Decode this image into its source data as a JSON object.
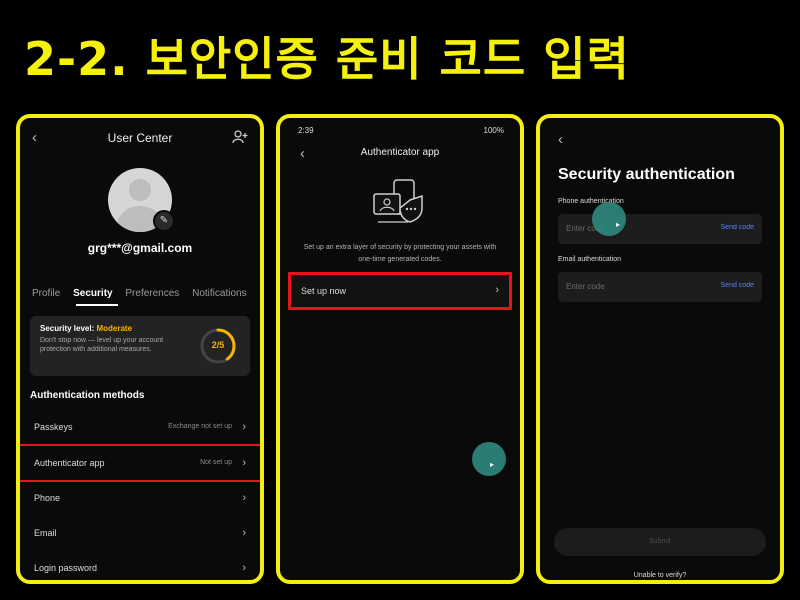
{
  "heading": "2-2. 보안인증 준비 코드 입력",
  "colors": {
    "accent_yellow": "#f3ee14",
    "highlight_red": "#e4141e",
    "security_orange": "#f5b400",
    "link_blue": "#4f86ff",
    "touch_teal": "#2f8a7e"
  },
  "panel1": {
    "title": "User Center",
    "email": "grg***@gmail.com",
    "tabs": [
      "Profile",
      "Security",
      "Preferences",
      "Notifications"
    ],
    "active_tab": "Security",
    "security_card": {
      "level_label": "Security level: ",
      "level_value": "Moderate",
      "description": "Don't stop now — level up your account protection with additional measures.",
      "progress_text": "2/5",
      "progress": 0.4
    },
    "auth_methods_heading": "Authentication methods",
    "auth_rows": [
      {
        "label": "Passkeys",
        "value": "Exchange not set up"
      },
      {
        "label": "Authenticator app",
        "value": "Not set up"
      },
      {
        "label": "Phone",
        "value": ""
      },
      {
        "label": "Email",
        "value": ""
      },
      {
        "label": "Login password",
        "value": ""
      }
    ]
  },
  "panel2": {
    "status_time": "2:39",
    "status_right": "100%",
    "title": "Authenticator app",
    "description": "Set up an extra layer of security by protecting your assets with one-time generated codes.",
    "setup_label": "Set up now"
  },
  "panel3": {
    "title": "Security authentication",
    "phone_label": "Phone authentication",
    "phone_placeholder": "Enter code",
    "phone_send": "Send code",
    "email_label": "Email authentication",
    "email_placeholder": "Enter code",
    "email_send": "Send code",
    "submit_label": "Submit",
    "unable_label": "Unable to verify?"
  }
}
